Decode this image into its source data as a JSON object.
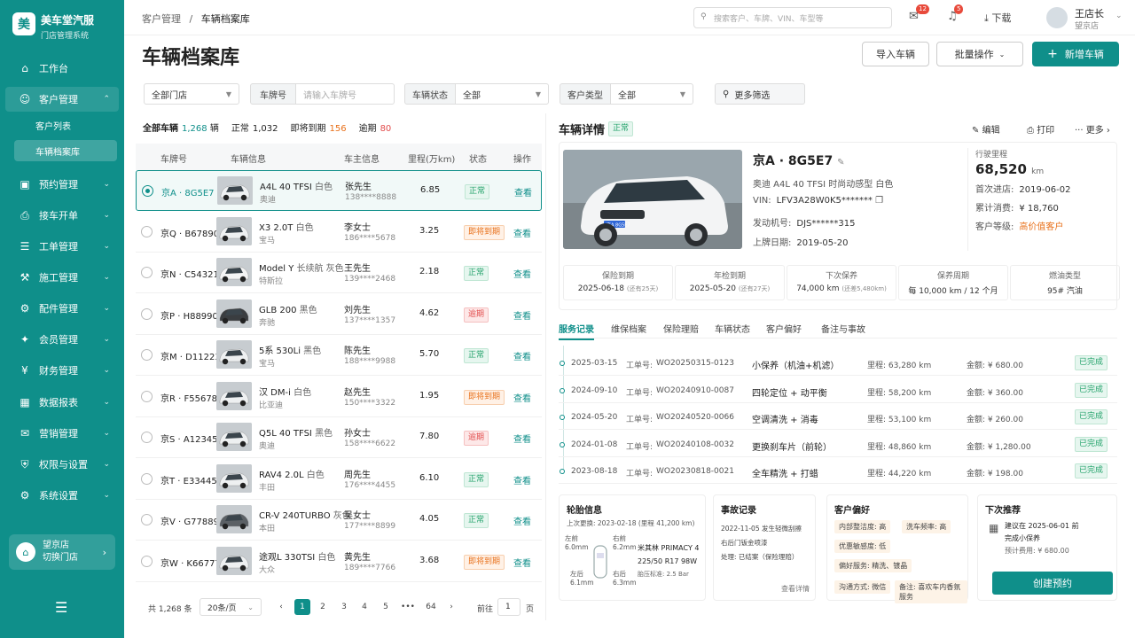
{
  "app": {
    "logo": "美",
    "name": "美车堂汽服",
    "sub": "门店管理系统"
  },
  "nav": [
    {
      "label": "工作台",
      "icon": "⌂"
    },
    {
      "label": "客户管理",
      "icon": "☺"
    },
    {
      "label": "预约管理",
      "icon": "▣"
    },
    {
      "label": "接车开单",
      "icon": "⎙"
    },
    {
      "label": "工单管理",
      "icon": "☰"
    },
    {
      "label": "施工管理",
      "icon": "⚒"
    },
    {
      "label": "配件管理",
      "icon": "⚙"
    },
    {
      "label": "会员管理",
      "icon": "✦"
    },
    {
      "label": "财务管理",
      "icon": "¥"
    },
    {
      "label": "数据报表",
      "icon": "▦"
    },
    {
      "label": "营销管理",
      "icon": "✉"
    },
    {
      "label": "权限与设置",
      "icon": "⛨"
    },
    {
      "label": "系统设置",
      "icon": "⚙"
    }
  ],
  "subnav": [
    "客户列表",
    "车辆档案库"
  ],
  "store": {
    "name": "望京店",
    "switch": "切换门店"
  },
  "breadcrumb": {
    "parent": "客户管理",
    "sep": "/",
    "current": "车辆档案库"
  },
  "search": {
    "placeholder": "搜索客户、车牌、VIN、车型等"
  },
  "notify": {
    "msg_count": "12",
    "bell_count": "5"
  },
  "download": "下载",
  "user": {
    "name": "王店长",
    "store": "望京店"
  },
  "page": {
    "title": "车辆档案库"
  },
  "actions": {
    "import": "导入车辆",
    "batch": "批量操作",
    "add": "新增车辆"
  },
  "filters": {
    "store": "全部门店",
    "plate_label": "车牌号",
    "plate_placeholder": "请输入车牌号",
    "status_label": "车辆状态",
    "status_value": "全部",
    "type_label": "客户类型",
    "type_value": "全部",
    "more": "更多筛选"
  },
  "summary": {
    "all_label": "全部车辆",
    "all": "1,268",
    "unit": "辆",
    "normal_label": "正常",
    "normal": "1,032",
    "soon_label": "即将到期",
    "soon": "156",
    "over_label": "逾期",
    "over": "80"
  },
  "table": {
    "headers": [
      "车牌号",
      "车辆信息",
      "车主信息",
      "里程(万km)",
      "状态",
      "操作"
    ],
    "rows": [
      {
        "plate": "京A · 8G5E7",
        "model": "A4L 40 TFSI",
        "color": "白色",
        "brand": "奥迪",
        "owner": "张先生",
        "phone": "138****8888",
        "km": "6.85",
        "status": "正常",
        "st": "normal",
        "car": "#eef0f1"
      },
      {
        "plate": "京Q · B67890",
        "model": "X3 2.0T",
        "color": "白色",
        "brand": "宝马",
        "owner": "李女士",
        "phone": "186****5678",
        "km": "3.25",
        "status": "即将到期",
        "st": "soon",
        "car": "#eef0f1"
      },
      {
        "plate": "京N · C54321",
        "model": "Model Y",
        "color": "长续航 灰色",
        "brand": "特斯拉",
        "owner": "王先生",
        "phone": "139****2468",
        "km": "2.18",
        "status": "正常",
        "st": "normal",
        "car": "#f4f4f4"
      },
      {
        "plate": "京P · H88990",
        "model": "GLB 200",
        "color": "黑色",
        "brand": "奔驰",
        "owner": "刘先生",
        "phone": "137****1357",
        "km": "4.62",
        "status": "逾期",
        "st": "over",
        "car": "#3a3d40"
      },
      {
        "plate": "京M · D11223",
        "model": "5系 530Li",
        "color": "黑色",
        "brand": "宝马",
        "owner": "陈先生",
        "phone": "188****9988",
        "km": "5.70",
        "status": "正常",
        "st": "normal",
        "car": "#eef0f1"
      },
      {
        "plate": "京R · F55678",
        "model": "汉 DM-i",
        "color": "白色",
        "brand": "比亚迪",
        "owner": "赵先生",
        "phone": "150****3322",
        "km": "1.95",
        "status": "即将到期",
        "st": "soon",
        "car": "#eef0f1"
      },
      {
        "plate": "京S · A12345",
        "model": "Q5L 40 TFSI",
        "color": "黑色",
        "brand": "奥迪",
        "owner": "孙女士",
        "phone": "158****6622",
        "km": "7.80",
        "status": "逾期",
        "st": "over",
        "car": "#eef0f1"
      },
      {
        "plate": "京T · E33445",
        "model": "RAV4 2.0L",
        "color": "白色",
        "brand": "丰田",
        "owner": "周先生",
        "phone": "176****4455",
        "km": "6.10",
        "status": "正常",
        "st": "normal",
        "car": "#eef0f1"
      },
      {
        "plate": "京V · G77889",
        "model": "CR-V 240TURBO",
        "color": "灰色",
        "brand": "本田",
        "owner": "吴女士",
        "phone": "177****8899",
        "km": "4.05",
        "status": "正常",
        "st": "normal",
        "car": "#5b6065"
      },
      {
        "plate": "京W · K66777",
        "model": "途观L 330TSI",
        "color": "白色",
        "brand": "大众",
        "owner": "黄先生",
        "phone": "189****7766",
        "km": "3.68",
        "status": "即将到期",
        "st": "soon",
        "car": "#eef0f1"
      }
    ],
    "view": "查看"
  },
  "pager": {
    "total": "共 1,268 条",
    "size": "20条/页",
    "pages": [
      "1",
      "2",
      "3",
      "4",
      "5",
      "•••",
      "64"
    ],
    "goto": "前往",
    "goto_val": "1",
    "page_unit": "页"
  },
  "detail": {
    "title": "车辆详情",
    "status": "正常",
    "edit": "编辑",
    "print": "打印",
    "more": "更多",
    "plate": "京A · 8G5E7",
    "model_line": "奥迪  A4L 40 TFSI 时尚动感型  白色",
    "vin_label": "VIN:",
    "vin": "LFV3A28W0K5*******",
    "engine_label": "发动机号:",
    "engine": "DJS******315",
    "reg_label": "上牌日期:",
    "reg": "2019-05-20",
    "mil_label": "行驶里程",
    "mil": "68,520",
    "mil_unit": "km",
    "first_label": "首次进店:",
    "first": "2019-06-02",
    "spend_label": "累计消费:",
    "spend": "¥ 18,760",
    "level_label": "客户等级:",
    "level": "高价值客户",
    "plate_badge": "京A 8G5E7"
  },
  "infoboxes": [
    {
      "t": "保险到期",
      "v": "2025-06-18",
      "n": "(还有25天)"
    },
    {
      "t": "年检到期",
      "v": "2025-05-20",
      "n": "(还有27天)"
    },
    {
      "t": "下次保养",
      "v": "74,000 km",
      "n": "(还差5,480km)"
    },
    {
      "t": "保养周期",
      "v": "每 10,000 km / 12 个月",
      "n": ""
    },
    {
      "t": "燃油类型",
      "v": "95# 汽油",
      "n": ""
    }
  ],
  "tabs": [
    "服务记录",
    "维保档案",
    "保险理赔",
    "车辆状态",
    "客户偏好",
    "备注与事故"
  ],
  "services": [
    {
      "date": "2025-03-15",
      "wo_label": "工单号:",
      "wo": "WO20250315-0123",
      "item": "小保养（机油+机滤）",
      "km": "里程: 63,280 km",
      "amt": "金额: ¥ 680.00",
      "st": "已完成"
    },
    {
      "date": "2024-09-10",
      "wo_label": "工单号:",
      "wo": "WO20240910-0087",
      "item": "四轮定位 + 动平衡",
      "km": "里程: 58,200 km",
      "amt": "金额: ¥ 360.00",
      "st": "已完成"
    },
    {
      "date": "2024-05-20",
      "wo_label": "工单号:",
      "wo": "WO20240520-0066",
      "item": "空调清洗 + 消毒",
      "km": "里程: 53,100 km",
      "amt": "金额: ¥ 260.00",
      "st": "已完成"
    },
    {
      "date": "2024-01-08",
      "wo_label": "工单号:",
      "wo": "WO20240108-0032",
      "item": "更换刹车片（前轮）",
      "km": "里程: 48,860 km",
      "amt": "金额: ¥ 1,280.00",
      "st": "已完成"
    },
    {
      "date": "2023-08-18",
      "wo_label": "工单号:",
      "wo": "WO20230818-0021",
      "item": "全车精洗 + 打蜡",
      "km": "里程: 44,220 km",
      "amt": "金额: ¥ 198.00",
      "st": "已完成"
    }
  ],
  "tire": {
    "title": "轮胎信息",
    "last": "上次更换:  2023-02-18 (里程 41,200 km)",
    "fl": "左前",
    "fl_v": "6.0mm",
    "fr": "右前",
    "fr_v": "6.2mm",
    "rl": "左后",
    "rl_v": "6.1mm",
    "rr": "右后",
    "rr_v": "6.3mm",
    "model": "米其林 PRIMACY 4",
    "size": "225/50 R17 98W",
    "pressure": "胎压标准: 2.5 Bar"
  },
  "accident": {
    "title": "事故记录",
    "l1": "2022-11-05 发生轻微刮擦",
    "l2": "右后门钣金喷漆",
    "l3": "处理: 已结案（保险理赔）",
    "more": "查看详情"
  },
  "prefs": {
    "title": "客户偏好",
    "chips": [
      "内部整洁度: 高",
      "洗车频率: 高",
      "优惠敏感度: 低",
      "偏好服务: 精洗、镀晶",
      "沟通方式: 微信",
      "备注: 喜欢车内香氛服务"
    ]
  },
  "next": {
    "title": "下次推荐",
    "l1": "建议在 2025-06-01 前",
    "l2": "完成小保养",
    "l3": "预计费用: ¥ 680.00",
    "btn": "创建预约"
  },
  "colors": {
    "accent": "#0f8f8a",
    "normal": "#24a36b",
    "soon": "#e8701a",
    "over": "#e24c4c"
  }
}
